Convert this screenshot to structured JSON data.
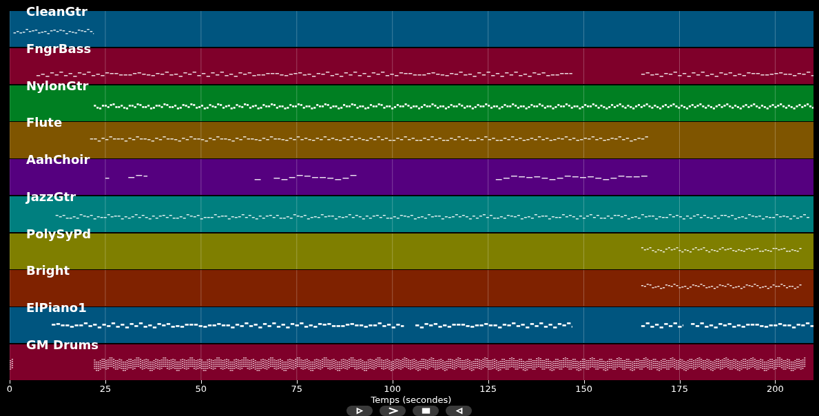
{
  "tracks": [
    {
      "name": "CleanGtr",
      "color": "#00557f"
    },
    {
      "name": "FngrBass",
      "color": "#7f002a"
    },
    {
      "name": "NylonGtr",
      "color": "#007f22"
    },
    {
      "name": "Flute",
      "color": "#7f5500"
    },
    {
      "name": "AahChoir",
      "color": "#55007f"
    },
    {
      "name": "JazzGtr",
      "color": "#007f7f"
    },
    {
      "name": "PolySyPd",
      "color": "#7f7f00"
    },
    {
      "name": "Bright",
      "color": "#7f2200"
    },
    {
      "name": "ElPiano1",
      "color": "#00557f"
    },
    {
      "name": "GM Drums",
      "color": "#7f002a"
    }
  ],
  "x_axis": {
    "ticks": [
      "0",
      "25",
      "50",
      "75",
      "100",
      "125",
      "150",
      "175",
      "200"
    ],
    "label": "Temps (secondes)"
  },
  "toolbar": [
    {
      "kind": "play"
    },
    {
      "kind": "forward"
    },
    {
      "kind": "stop"
    },
    {
      "kind": "back"
    }
  ]
}
